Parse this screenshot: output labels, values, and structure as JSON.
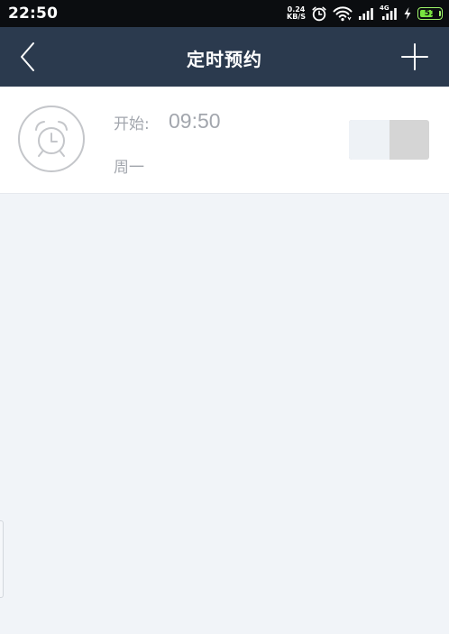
{
  "status_bar": {
    "time": "22:50",
    "net_speed_value": "0.24",
    "net_speed_unit": "KB/S",
    "signal_label": "4G",
    "battery_level": "51",
    "icons": [
      "alarm-icon",
      "wifi-icon",
      "signal-icon",
      "signal-4g-icon",
      "charging-icon",
      "battery-icon"
    ]
  },
  "app_bar": {
    "title": "定时预约",
    "back_icon": "chevron-left-icon",
    "add_icon": "plus-icon"
  },
  "schedule": {
    "start_label": "开始:",
    "start_time": "09:50",
    "days": "周一",
    "enabled": false,
    "icon": "alarm-clock-icon"
  },
  "colors": {
    "status_bar_bg": "#0b0d10",
    "app_bar_bg": "#2b3a4e",
    "page_bg": "#f1f4f8",
    "card_bg": "#ffffff",
    "muted_text": "#a2a6ad",
    "toggle_off": "#d5d5d5",
    "battery": "#78e33f"
  }
}
